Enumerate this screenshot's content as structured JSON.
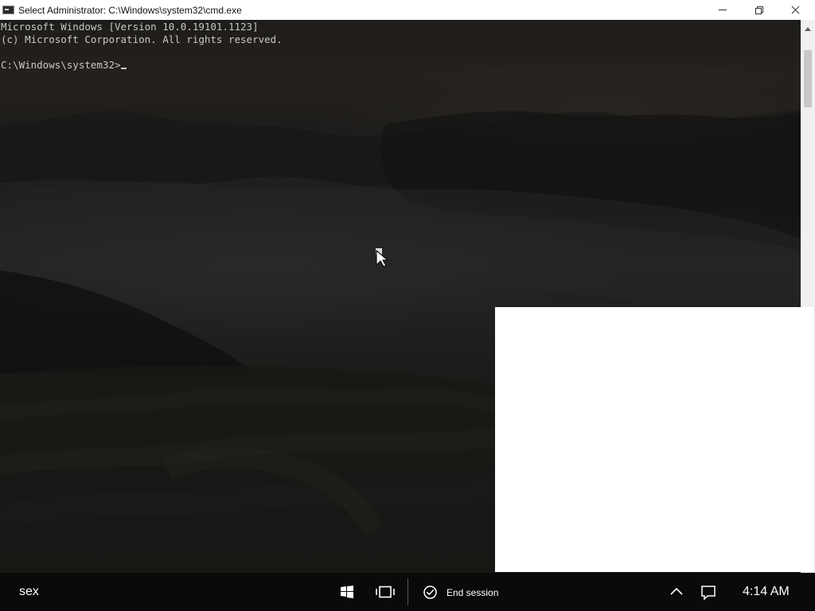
{
  "window": {
    "title": "Select Administrator: C:\\Windows\\system32\\cmd.exe"
  },
  "console": {
    "lines": [
      "Microsoft Windows [Version 10.0.19101.1123]",
      "(c) Microsoft Corporation. All rights reserved.",
      "C:\\Windows\\system32>"
    ]
  },
  "taskbar": {
    "session_name": "sex",
    "end_session_label": "End session",
    "clock": "4:14 AM"
  },
  "icons": {
    "app": "cmd-icon",
    "minimize": "minimize-icon",
    "restore": "restore-icon",
    "close": "close-icon",
    "windows": "windows-icon",
    "task_view": "task-view-icon",
    "check": "check-circle-icon",
    "chevron": "chevron-up-icon",
    "notification": "notification-icon",
    "cursor": "mouse-pointer-icon"
  },
  "colors": {
    "taskbar": "#0a0a0a",
    "titlebar": "#ffffff",
    "console_text": "#c8c8c8",
    "overlay": "#ffffff"
  }
}
